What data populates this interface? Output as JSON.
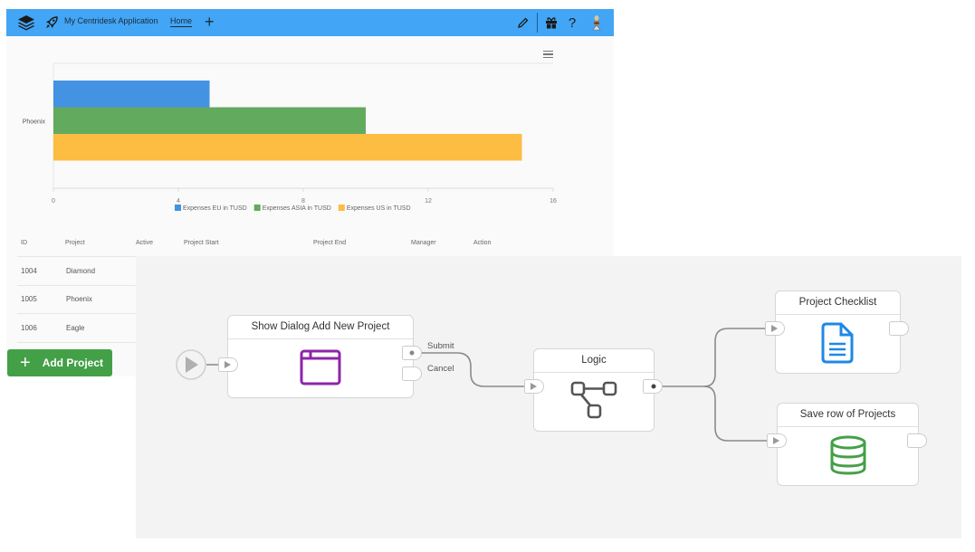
{
  "header": {
    "app_title": "My Centridesk Application",
    "tabs": [
      {
        "label": "Home",
        "active": true
      }
    ],
    "add_tab_label": "+",
    "icons": [
      "layers-icon",
      "rocket-icon",
      "pencil-icon",
      "gift-icon",
      "help-icon",
      "user-avatar-icon"
    ],
    "help_glyph": "?",
    "color": "#42a5f5"
  },
  "chart_data": {
    "type": "bar",
    "orientation": "horizontal",
    "categories": [
      "Phoenix"
    ],
    "series": [
      {
        "name": "Expenses EU in TUSD",
        "values": [
          5
        ],
        "color": "#4393e2"
      },
      {
        "name": "Expenses ASIA in TUSD",
        "values": [
          10
        ],
        "color": "#62aa5e"
      },
      {
        "name": "Expenses US in TUSD",
        "values": [
          15
        ],
        "color": "#fdbc42"
      }
    ],
    "title": "",
    "xlabel": "",
    "ylabel": "",
    "xlim": [
      0,
      16
    ],
    "xticks": [
      "0",
      "4",
      "8",
      "12",
      "16"
    ],
    "grid": true,
    "legend": "bottom"
  },
  "table": {
    "columns": [
      "ID",
      "Project",
      "Active",
      "Project Start",
      "Project End",
      "Manager",
      "Action"
    ],
    "rows": [
      {
        "id": "1004",
        "project": "Diamond"
      },
      {
        "id": "1005",
        "project": "Phoenix"
      },
      {
        "id": "1006",
        "project": "Eagle"
      }
    ]
  },
  "add_button": {
    "label": "Add Project",
    "color": "#43a047"
  },
  "workflow": {
    "nodes": [
      {
        "title": "Show Dialog Add New Project",
        "icon": "window-icon",
        "outputs": [
          "Submit",
          "Cancel"
        ],
        "icon_color": "#8e24aa"
      },
      {
        "title": "Logic",
        "icon": "flow-logic-icon",
        "icon_color": "#555555"
      },
      {
        "title": "Project Checklist",
        "icon": "document-icon",
        "icon_color": "#1e88e5"
      },
      {
        "title": "Save row of Projects",
        "icon": "database-icon",
        "icon_color": "#43a047"
      }
    ]
  }
}
